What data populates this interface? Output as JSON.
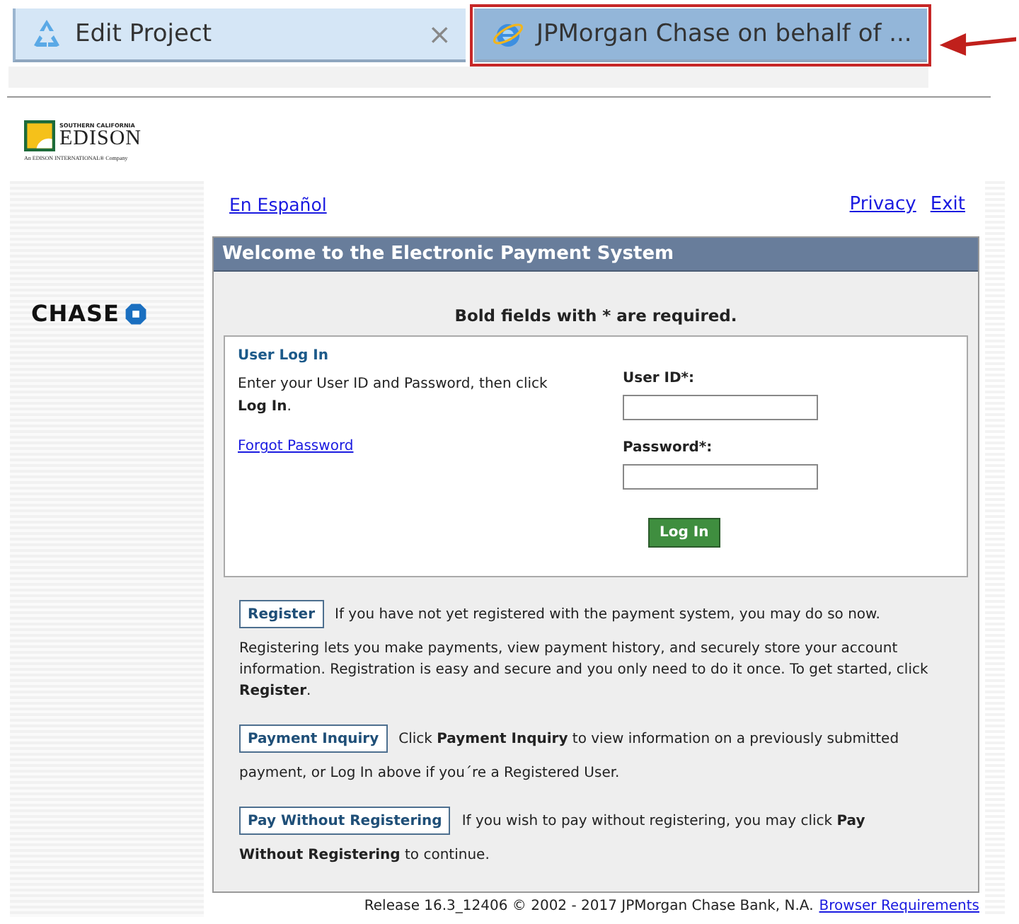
{
  "browser_tabs": [
    {
      "title": "Edit Project",
      "selected": false,
      "highlighted": false,
      "close": "×"
    },
    {
      "title": "JPMorgan Chase on behalf of ...",
      "selected": true,
      "highlighted": true
    }
  ],
  "brand": {
    "top": "SOUTHERN CALIFORNIA",
    "name": "EDISON",
    "tagline": "An EDISON INTERNATIONAL® Company"
  },
  "sidebar": {
    "bank": "CHASE"
  },
  "top_links": {
    "language": "En Español",
    "right": [
      "Privacy",
      "Exit"
    ]
  },
  "panel": {
    "title": "Welcome to the Electronic Payment System",
    "required_note": "Bold fields with * are required.",
    "login": {
      "heading": "User Log In",
      "instructions": "Enter your User ID and Password, then click **Log In**.",
      "forgot": "Forgot Password",
      "fields": [
        {
          "label": "User ID*:"
        },
        {
          "label": "Password*:"
        }
      ],
      "submit": "Log In"
    },
    "actions": [
      {
        "button": "Register",
        "inline": "If you have not yet registered with the payment system, you may do so now.",
        "more": "Registering lets you make payments, view payment history, and securely store your account information. Registration is easy and secure and you only need to do it once. To get started, click **Register**."
      },
      {
        "button": "Payment Inquiry",
        "inline": "Click **Payment Inquiry** to view information on a previously submitted",
        "more": "payment, or Log In above if you´re a Registered User."
      },
      {
        "button": "Pay Without Registering",
        "inline": "If you wish to pay without registering, you may click **Pay**",
        "more": "**Without Registering** to continue."
      }
    ]
  },
  "footer": {
    "release": "Release 16.3_12406 © 2002 - 2017 JPMorgan Chase Bank, N.A.",
    "link": "Browser Requirements"
  }
}
